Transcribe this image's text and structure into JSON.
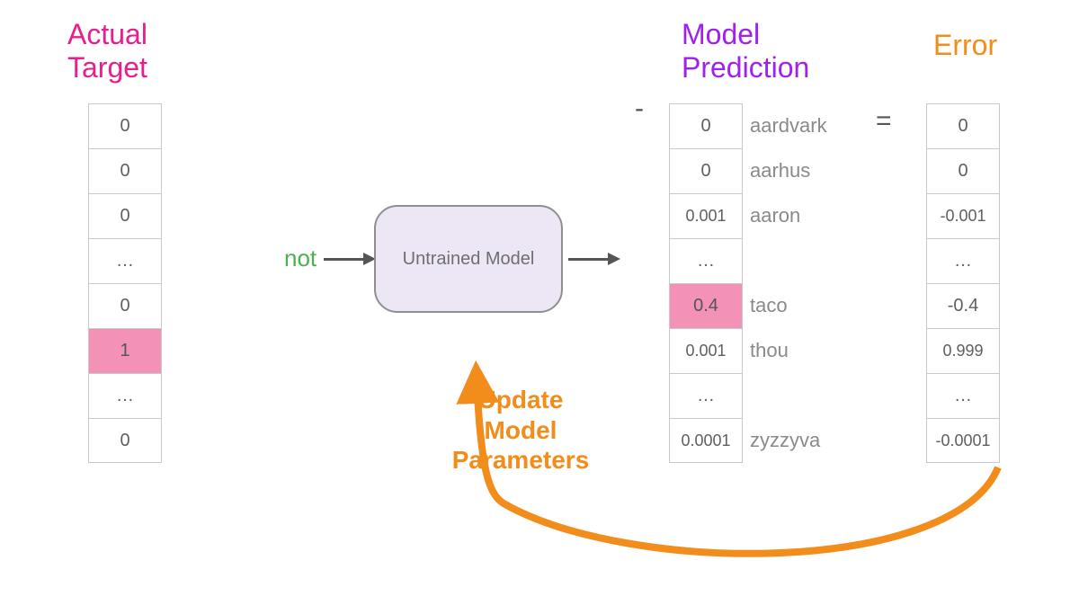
{
  "headings": {
    "target": "Actual\nTarget",
    "prediction": "Model\nPrediction",
    "error": "Error"
  },
  "input_word": "not",
  "model_label": "Untrained Model",
  "operators": {
    "minus": "-",
    "equals": "="
  },
  "update_text": "Update\nModel\nParameters",
  "target_vector": [
    {
      "value": "0",
      "highlight": false
    },
    {
      "value": "0",
      "highlight": false
    },
    {
      "value": "0",
      "highlight": false
    },
    {
      "value": "…",
      "highlight": false
    },
    {
      "value": "0",
      "highlight": false
    },
    {
      "value": "1",
      "highlight": true
    },
    {
      "value": "…",
      "highlight": false
    },
    {
      "value": "0",
      "highlight": false
    }
  ],
  "prediction_vector": [
    {
      "value": "0",
      "word": "aardvark",
      "highlight": false
    },
    {
      "value": "0",
      "word": "aarhus",
      "highlight": false
    },
    {
      "value": "0.001",
      "word": "aaron",
      "highlight": false
    },
    {
      "value": "…",
      "word": "",
      "highlight": false
    },
    {
      "value": "0.4",
      "word": "taco",
      "highlight": true
    },
    {
      "value": "0.001",
      "word": "thou",
      "highlight": false
    },
    {
      "value": "…",
      "word": "",
      "highlight": false
    },
    {
      "value": "0.0001",
      "word": "zyzzyva",
      "highlight": false
    }
  ],
  "error_vector": [
    {
      "value": "0"
    },
    {
      "value": "0"
    },
    {
      "value": "-0.001"
    },
    {
      "value": "…"
    },
    {
      "value": "-0.4"
    },
    {
      "value": "0.999"
    },
    {
      "value": "…"
    },
    {
      "value": "-0.0001"
    }
  ],
  "colors": {
    "pink_heading": "#e91e8c",
    "purple_heading": "#a020f0",
    "orange": "#f28c1a",
    "green_input": "#4caf50",
    "highlight_bg": "#f391b7",
    "model_bg": "#ece6f5"
  }
}
